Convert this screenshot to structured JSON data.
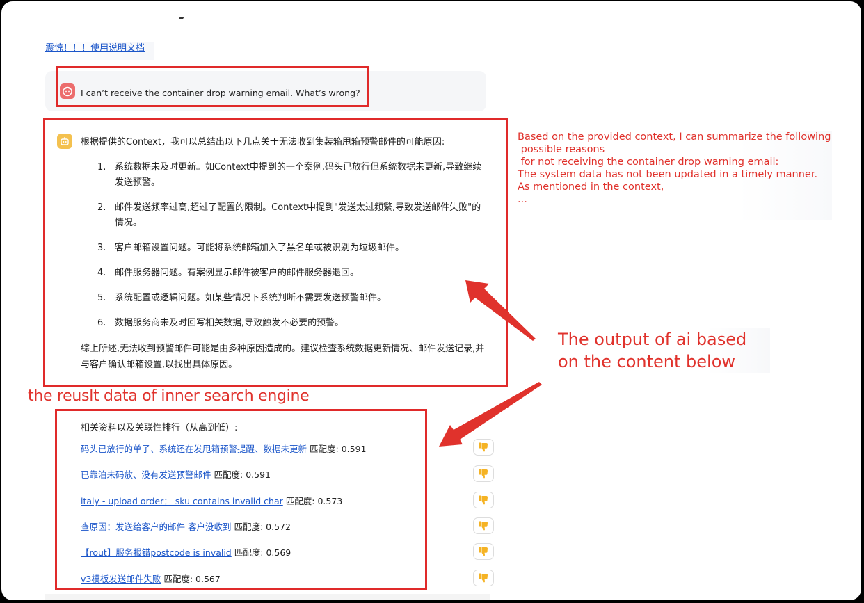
{
  "header": {
    "doc_link": "震惊！！！使用说明文档"
  },
  "chat": {
    "user_question": "I can’t receive the container drop warning email. What’s wrong?",
    "answer": {
      "intro": "根据提供的Context，我可以总结出以下几点关于无法收到集装箱甩箱预警邮件的可能原因:",
      "items": [
        {
          "num": "1.",
          "text": "系统数据未及时更新。如Context中提到的一个案例,码头已放行但系统数据未更新,导致继续发送预警。"
        },
        {
          "num": "2.",
          "text": "邮件发送频率过高,超过了配置的限制。Context中提到\"发送太过频繁,导致发送邮件失败\"的情况。"
        },
        {
          "num": "3.",
          "text": "客户邮箱设置问题。可能将系统邮箱加入了黑名单或被识别为垃圾邮件。"
        },
        {
          "num": "4.",
          "text": "邮件服务器问题。有案例显示邮件被客户的邮件服务器退回。"
        },
        {
          "num": "5.",
          "text": "系统配置或逻辑问题。如某些情况下系统判断不需要发送预警邮件。"
        },
        {
          "num": "6.",
          "text": "数据服务商未及时回写相关数据,导致触发不必要的预警。"
        }
      ],
      "summary": "综上所述,无法收到预警邮件可能是由多种原因造成的。建议检查系统数据更新情况、邮件发送记录,并与客户确认邮箱设置,以找出具体原因。"
    }
  },
  "annotations": {
    "translation": "Based on the provided context, I can summarize the following\n possible reasons\n for not receiving the container drop warning email:\nThe system data has not been updated in a timely manner.\nAs mentioned in the context,\n...",
    "output_note": "The output of ai based on the content below",
    "search_note": "the reuslt data of inner search engine",
    "color": "#e0322c"
  },
  "results": {
    "title": "相关资料以及关联性排行（从高到低）:",
    "score_label": "匹配度:",
    "items": [
      {
        "title": "码头已放行的单子、系统还在发甩箱预警提醒、数据未更新",
        "score": "0.591"
      },
      {
        "title": "已靠泊未码放、没有发送预警邮件",
        "score": "0.591"
      },
      {
        "title": "italy - upload order：  sku contains invalid char",
        "score": "0.573"
      },
      {
        "title": "查原因：发送给客户的邮件 客户没收到",
        "score": "0.572"
      },
      {
        "title": "【rout】服务报错postcode is invalid",
        "score": "0.569"
      },
      {
        "title": "v3模板发送邮件失败",
        "score": "0.567"
      }
    ],
    "feedback_icon": "thumbs-down-icon"
  },
  "colors": {
    "link": "#1a55c9",
    "user_avatar": "#ec6d6d",
    "bot_avatar": "#f4c14f",
    "thumb": "#f5b324"
  }
}
